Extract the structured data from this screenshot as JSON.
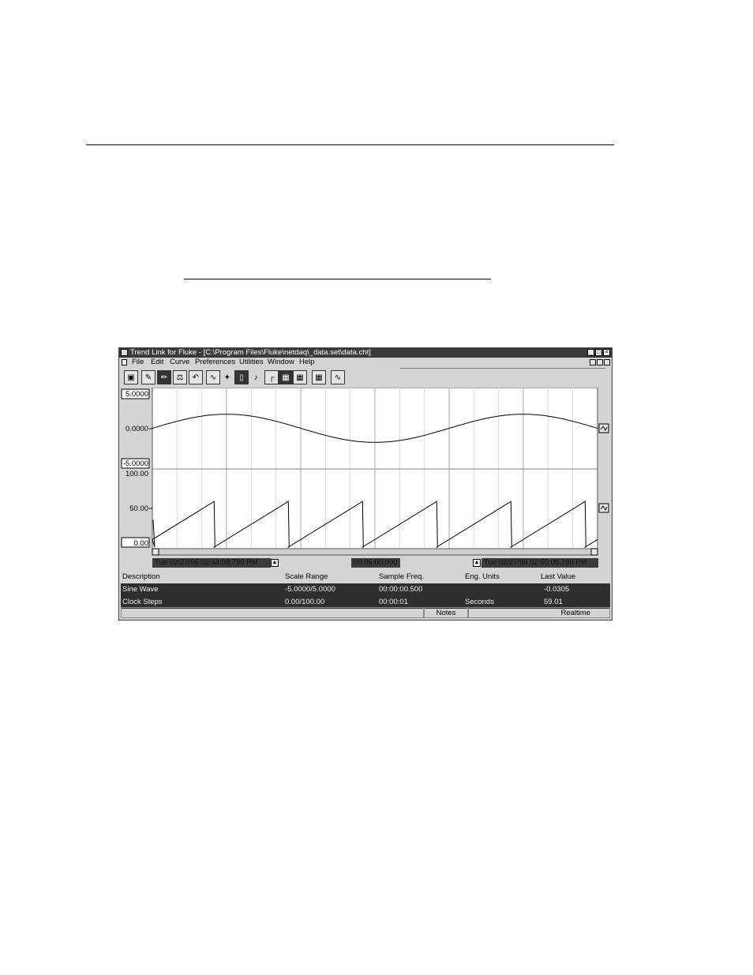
{
  "window": {
    "title": "Trend Link for Fluke - [C:\\Program Files\\Fluke\\netdaq\\_data.set\\data.cht]",
    "controls": [
      "minimize-icon",
      "maximize-icon",
      "close-icon"
    ]
  },
  "menu": {
    "items": [
      "File",
      "Edit",
      "Curve",
      "Preferences",
      "Utilities",
      "Window",
      "Help"
    ]
  },
  "toolbar": {
    "buttons": [
      "open-chart-icon",
      "edit-icon",
      "pencil-icon",
      "scale-icon",
      "undo-icon",
      "add-curve-icon",
      "probe-icon",
      "eraser-icon",
      "note-icon",
      "cursor-icon",
      "grid-icon",
      "table-icon",
      "calculator-icon",
      "trend-icon"
    ]
  },
  "chart_data": {
    "type": "line",
    "panes": [
      {
        "series_name": "Sine Wave",
        "y_ticks": [
          "5.0000",
          "0.0000",
          "-5.0000"
        ],
        "ylim": [
          -5,
          5
        ],
        "x": [
          0,
          30,
          60,
          90,
          120,
          150,
          180,
          210,
          240,
          270,
          300,
          330,
          360
        ],
        "values": [
          0.0,
          1.3,
          1.8,
          1.2,
          -0.1,
          -1.3,
          -1.8,
          -1.3,
          0.0,
          1.3,
          1.8,
          1.3,
          0.0
        ]
      },
      {
        "series_name": "Clock Steps",
        "y_ticks": [
          "100.00",
          "50.00",
          "0.00"
        ],
        "ylim": [
          0,
          100
        ],
        "sawtooth_period_s": 60,
        "sawtooth_peak": 59
      }
    ]
  },
  "timebar": {
    "start": "Tue 02/27/96 02:44:08.780 PM",
    "span": "00:06:00.000",
    "end": "Tue 02/27/96 02:50:08.780 PM"
  },
  "table": {
    "headers": [
      "Description",
      "Scale Range",
      "Sample Freq.",
      "Eng. Units",
      "Last Value"
    ],
    "rows": [
      [
        "Sine Wave",
        "-5.0000/5.0000",
        "00:00:00.500",
        "",
        "-0.0305"
      ],
      [
        "Clock Steps",
        "0.00/100.00",
        "00:00:01",
        "Seconds",
        "59.01"
      ]
    ]
  },
  "status": {
    "notes": "Notes",
    "mode": "Realtime"
  }
}
